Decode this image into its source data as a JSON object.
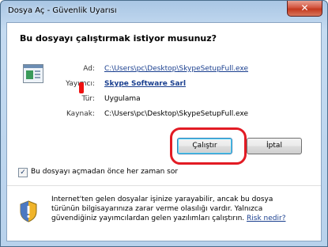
{
  "window": {
    "title": "Dosya Aç - Güvenlik Uyarısı",
    "close_glyph": "✕"
  },
  "heading": "Bu dosyayı çalıştırmak istiyor musunuz?",
  "file_icon": "application-window-icon",
  "details": {
    "name_label": "Ad:",
    "name_value": "C:\\Users\\pc\\Desktop\\SkypeSetupFull.exe",
    "publisher_label": "Yayımcı:",
    "publisher_value": "Skype Software Sarl",
    "type_label": "Tür:",
    "type_value": "Uygulama",
    "from_label": "Kaynak:",
    "from_value": "C:\\Users\\pc\\Desktop\\SkypeSetupFull.exe"
  },
  "buttons": {
    "run": "Çalıştır",
    "cancel": "İptal"
  },
  "checkbox": {
    "checked": true,
    "mark": "✓",
    "label": "Bu dosyayı açmadan önce her zaman sor"
  },
  "warning": {
    "icon": "shield-warning-icon",
    "text": "Internet'ten gelen dosyalar işinize yarayabilir, ancak bu dosya türünün bilgisayarınıza zarar verme olasılığı vardır. Yalnızca güvendiğiniz yayımcılardan gelen yazılımları çalıştırın.",
    "link": "Risk nedir?"
  },
  "colors": {
    "annotation_red": "#e21b24",
    "link_blue": "#1a3f8f",
    "title_bar": "#b8d2ec"
  }
}
